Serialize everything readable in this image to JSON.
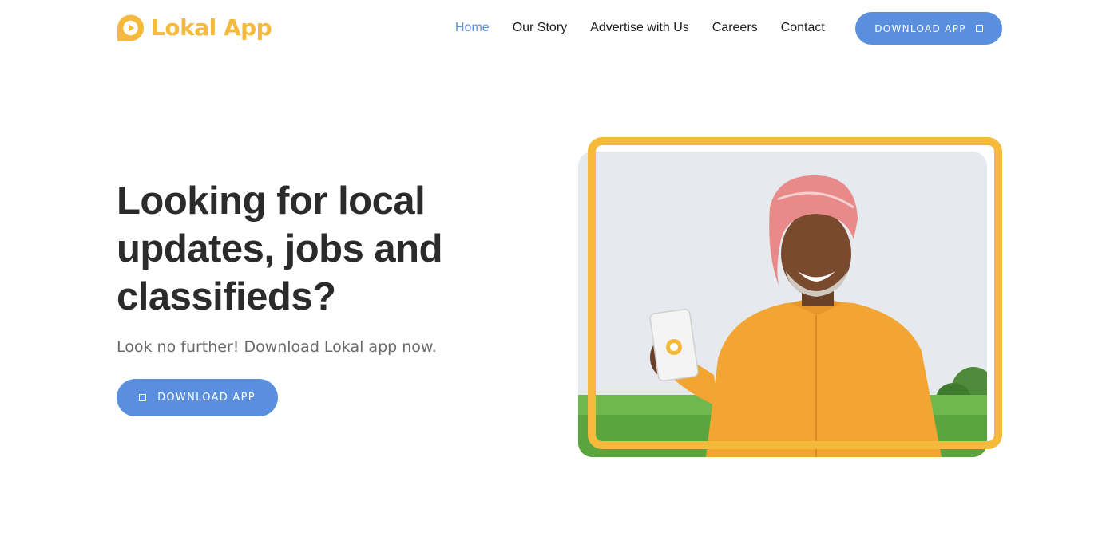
{
  "brand": {
    "name": "Lokal App",
    "logo_icon": "play-bubble-icon",
    "color": "#f5b93c"
  },
  "nav": {
    "items": [
      {
        "label": "Home",
        "active": true
      },
      {
        "label": "Our Story",
        "active": false
      },
      {
        "label": "Advertise with Us",
        "active": false
      },
      {
        "label": "Careers",
        "active": false
      },
      {
        "label": "Contact",
        "active": false
      }
    ],
    "download_label": "DOWNLOAD APP",
    "download_icon": "square-icon"
  },
  "hero": {
    "headline": "Looking for local updates, jobs and classifieds?",
    "subtext": "Look no further! Download Lokal app now.",
    "download_label": "DOWNLOAD APP",
    "download_icon": "square-icon",
    "image": "farmer-holding-phone-photo"
  },
  "colors": {
    "accent": "#5a8fe0",
    "frame": "#f5b93c",
    "text": "#2b2b2b"
  }
}
